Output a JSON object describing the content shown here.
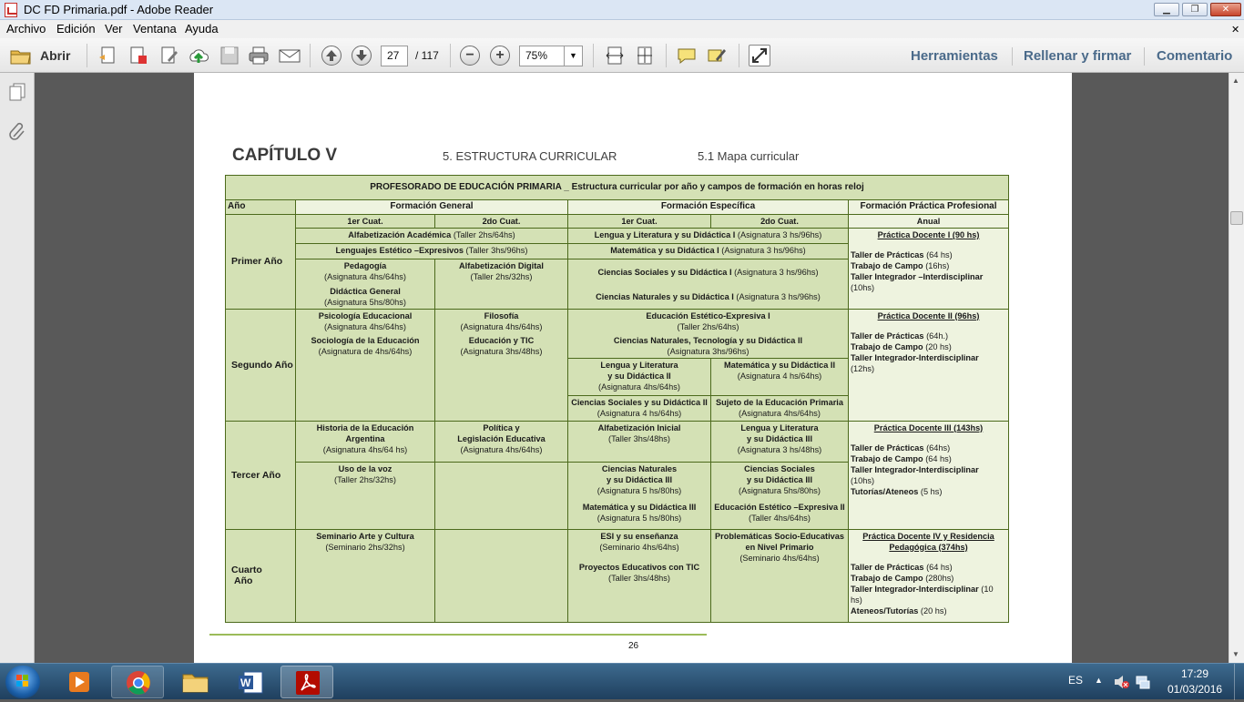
{
  "window": {
    "title": "DC FD Primaria.pdf - Adobe Reader",
    "minimize": "▁",
    "restore": "❐",
    "close": "✕"
  },
  "menu": [
    "Archivo",
    "Edición",
    "Ver",
    "Ventana",
    "Ayuda"
  ],
  "menu_close": "✕",
  "toolbar": {
    "open_label": "Abrir",
    "page_current": "27",
    "page_total": "/ 117",
    "zoom": "75%",
    "minus": "−",
    "plus": "+",
    "right_links": [
      "Herramientas",
      "Rellenar y firmar",
      "Comentario"
    ]
  },
  "doc": {
    "chapter": "CAPÍTULO V",
    "section": "5. ESTRUCTURA CURRICULAR",
    "subsection": "5.1 Mapa curricular",
    "page_number": "26",
    "table": {
      "title": "PROFESORADO DE EDUCACIÓN PRIMARIA _  Estructura curricular por año y campos de formación en horas reloj",
      "col_year": "Año",
      "col_general": "Formación General",
      "col_especifica": "Formación Específica",
      "col_practica": "Formación Práctica Profesional",
      "sub_1er": "1er Cuat.",
      "sub_2do": "2do Cuat.",
      "sub_anual": "Anual",
      "year1": "Primer Año",
      "year2": "Segundo Año",
      "year3": "Tercer Año",
      "year4a": "Cuarto",
      "year4b": "Año",
      "y1_alfa_b": "Alfabetización Académica",
      "y1_alfa_r": " (Taller 2hs/64hs)",
      "y1_leng_b": "Lenguajes Estético –Expresivos",
      "y1_leng_r": " (Taller 3hs/96hs)",
      "y1_ped": "Pedagogía",
      "y1_ped_d": "(Asignatura 4hs/64hs)",
      "y1_dida": "Didáctica General",
      "y1_dida_d": "(Asignatura 5hs/80hs)",
      "y1_alfd1": "Alfabetización  Digital",
      "y1_alfd2": "(Taller 2hs/32hs)",
      "y1_e1_b": "Lengua y Literatura y su Didáctica I",
      "y1_e1_r": " (Asignatura 3 hs/96hs)",
      "y1_e2_b": "Matemática y su Didáctica I",
      "y1_e2_r": " (Asignatura 3 hs/96hs)",
      "y1_e3_b": "Ciencias Sociales y su Didáctica I",
      "y1_e3_r": " (Asignatura 3 hs/96hs)",
      "y1_e4_b": "Ciencias Naturales y su Didáctica I",
      "y1_e4_r": " (Asignatura 3 hs/96hs)",
      "y1_pr_t": "Práctica Docente I  (90 hs)",
      "y1_pr_1b": "Taller de Prácticas",
      "y1_pr_1r": " (64 hs)",
      "y1_pr_2b": "Trabajo  de Campo",
      "y1_pr_2r": " (16hs)",
      "y1_pr_3b": "Taller Integrador –Interdisciplinar",
      "y1_pr_3r": "(10hs)",
      "y2_psi": "Psicología Educacional",
      "y2_psi_d": "(Asignatura 4hs/64hs)",
      "y2_soc": "Sociología de la Educación",
      "y2_soc_d": "(Asignatura de 4hs/64hs)",
      "y2_fil": "Filosofía",
      "y2_fil_d": "(Asignatura 4hs/64hs)",
      "y2_tic": "Educación y TIC",
      "y2_tic_d": "(Asignatura 3hs/48hs)",
      "y2_ee": "Educación Estético-Expresiva I",
      "y2_ee_d": "(Taller 2hs/64hs)",
      "y2_cn": "Ciencias Naturales, Tecnología y su Didáctica II",
      "y2_cn_d": "(Asignatura 3hs/96hs)",
      "y2_ll1": "Lengua y Literatura",
      "y2_ll2": "y su Didáctica II",
      "y2_ll_d": "(Asignatura 4hs/64hs)",
      "y2_mat": "Matemática y su Didáctica II",
      "y2_mat_d": "(Asignatura 4 hs/64hs)",
      "y2_cs": "Ciencias Sociales y su Didáctica II",
      "y2_cs_d": "(Asignatura 4 hs/64hs)",
      "y2_suj": "Sujeto de la Educación Primaria",
      "y2_suj_d": "(Asignatura 4hs/64hs)",
      "y2_pr_t": "Práctica Docente II (96hs)",
      "y2_pr_1b": "Taller de Prácticas",
      "y2_pr_1r": " (64h.)",
      "y2_pr_2b": "Trabajo de Campo",
      "y2_pr_2r": " (20 hs)",
      "y2_pr_3b": "Taller Integrador-Interdisciplinar",
      "y2_pr_3r": "(12hs)",
      "y3_his1": "Historia de la Educación",
      "y3_his2": "Argentina",
      "y3_his_d": "(Asignatura 4hs/64 hs)",
      "y3_pol1": "Política y",
      "y3_pol2": "Legislación  Educativa",
      "y3_pol_d": "(Asignatura 4hs/64hs)",
      "y3_voz": "Uso de la voz",
      "y3_voz_d": "(Taller 2hs/32hs)",
      "y3_alf": "Alfabetización Inicial",
      "y3_alf_d": "(Taller 3hs/48hs)",
      "y3_ll1": "Lengua y Literatura",
      "y3_ll2": "y su Didáctica III",
      "y3_ll_d": "(Asignatura 3 hs/48hs)",
      "y3_cn1": "Ciencias Naturales",
      "y3_cn2": "y su Didáctica III",
      "y3_cn_d": "(Asignatura 5 hs/80hs)",
      "y3_cs1": "Ciencias Sociales",
      "y3_cs2": "y su Didáctica III",
      "y3_cs_d": "(Asignatura 5hs/80hs)",
      "y3_mat": "Matemática y su Didáctica III",
      "y3_mat_d": "(Asignatura 5 hs/80hs)",
      "y3_ee": "Educación Estético –Expresiva II",
      "y3_ee_d": "(Taller 4hs/64hs)",
      "y3_pr_t": "Práctica Docente III  (143hs)",
      "y3_pr_1b": "Taller de Prácticas",
      "y3_pr_1r": "  (64hs)",
      "y3_pr_2b": "Trabajo de Campo",
      "y3_pr_2r": " (64 hs)",
      "y3_pr_3b": "Taller Integrador-Interdisciplinar",
      "y3_pr_3r": "(10hs)",
      "y3_pr_4b": "Tutorías/Ateneos",
      "y3_pr_4r": " (5 hs)",
      "y4_sem": "Seminario Arte y Cultura",
      "y4_sem_d": "(Seminario 2hs/32hs)",
      "y4_esi": "ESI y su enseñanza",
      "y4_esi_d": "(Seminario 4hs/64hs)",
      "y4_pe": "Proyectos Educativos con TIC",
      "y4_pe_d": "(Taller 3hs/48hs)",
      "y4_prob1": "Problemáticas Socio-Educativas",
      "y4_prob2": "en Nivel Primario",
      "y4_prob_d": "(Seminario 4hs/64hs)",
      "y4_pr_t1": "Práctica Docente IV y Residencia",
      "y4_pr_t2": "Pedagógica (374hs)",
      "y4_pr_1b": "Taller de Prácticas",
      "y4_pr_1r": " (64 hs)",
      "y4_pr_2b": "Trabajo de Campo",
      "y4_pr_2r": " (280hs)",
      "y4_pr_3b": "Taller  Integrador-Interdisciplinar",
      "y4_pr_3r": "  (10 hs)",
      "y4_pr_4b": "Ateneos/Tutorías",
      "y4_pr_4r": "   (20 hs)"
    }
  },
  "taskbar": {
    "lang": "ES",
    "time": "17:29",
    "date": "01/03/2016",
    "tray_up": "▲"
  },
  "icons": {
    "start": "windows-start-icon",
    "chrome": "chrome-icon",
    "media": "media-player-icon",
    "explorer": "folder-icon",
    "word": "word-icon",
    "acrobat": "adobe-reader-icon"
  }
}
